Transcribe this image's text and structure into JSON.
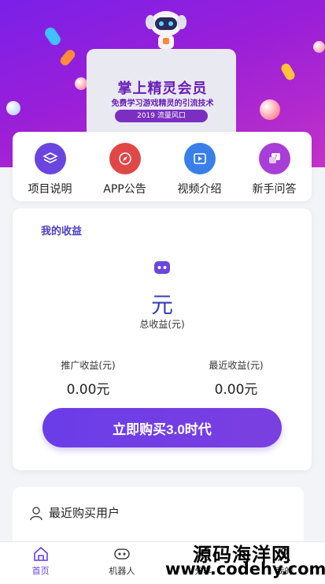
{
  "banner": {
    "title": "掌上精灵会员",
    "subtitle": "免费学习游戏精灵的引流技术",
    "pill": "2019 流量风口"
  },
  "quick": [
    {
      "label": "项目说明",
      "icon": "layers-icon",
      "color": "#6a45e0"
    },
    {
      "label": "APP公告",
      "icon": "compass-icon",
      "color": "#e04848"
    },
    {
      "label": "视频介绍",
      "icon": "video-icon",
      "color": "#3a7ee8"
    },
    {
      "label": "新手问答",
      "icon": "question-chat-icon",
      "color": "#a83ed8"
    }
  ],
  "earnings": {
    "heading": "我的收益",
    "icon": "robot-icon",
    "total_value": "元",
    "total_label": "总收益(元)",
    "promo_label": "推广收益(元)",
    "promo_value": "0.00元",
    "recent_label": "最近收益(元)",
    "recent_value": "0.00元",
    "buy_button": "立即购买3.0时代"
  },
  "recent_buyers": {
    "title": "最近购买用户",
    "icon": "user-icon"
  },
  "tabbar": [
    {
      "label": "首页",
      "icon": "home-icon",
      "active": true
    },
    {
      "label": "机器人",
      "icon": "robot-icon",
      "active": false
    },
    {
      "label": "分享",
      "icon": "share-icon",
      "active": false
    },
    {
      "label": "我的",
      "icon": "profile-icon",
      "active": false
    }
  ],
  "watermark": {
    "line1": "源码海洋网",
    "line2": "www.codehy.com"
  },
  "colors": {
    "accent": "#6a3de8",
    "banner_start": "#7a20e8",
    "banner_end": "#c232c7"
  }
}
